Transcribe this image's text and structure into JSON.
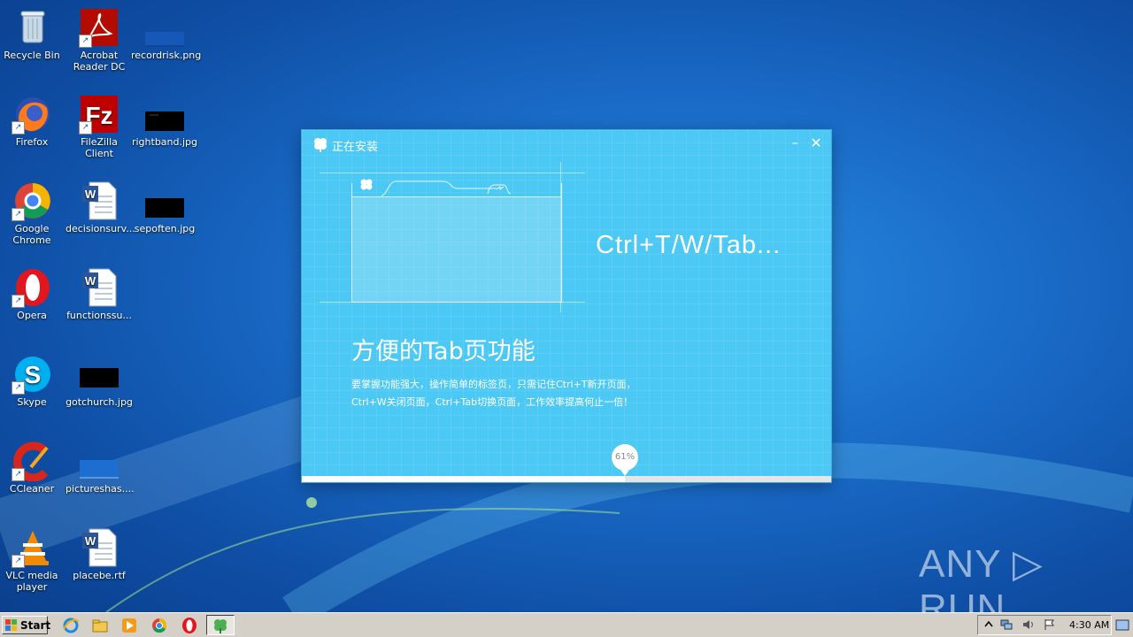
{
  "desktop": {
    "icons": [
      {
        "label": "Recycle Bin",
        "icon": "recycle-bin-icon"
      },
      {
        "label": "Acrobat Reader DC",
        "icon": "acrobat-icon"
      },
      {
        "label": "recordrisk.png",
        "icon": "image-file-icon"
      },
      {
        "label": "Firefox",
        "icon": "firefox-icon"
      },
      {
        "label": "FileZilla Client",
        "icon": "filezilla-icon"
      },
      {
        "label": "rightband.jpg",
        "icon": "image-file-icon"
      },
      {
        "label": "Google Chrome",
        "icon": "chrome-icon"
      },
      {
        "label": "decisionsurv...",
        "icon": "word-doc-icon"
      },
      {
        "label": "sepoften.jpg",
        "icon": "image-file-icon"
      },
      {
        "label": "Opera",
        "icon": "opera-icon"
      },
      {
        "label": "functionssu...",
        "icon": "word-doc-icon"
      },
      {
        "label": "Skype",
        "icon": "skype-icon"
      },
      {
        "label": "gotchurch.jpg",
        "icon": "image-file-icon"
      },
      {
        "label": "CCleaner",
        "icon": "ccleaner-icon"
      },
      {
        "label": "pictureshas....",
        "icon": "image-file-icon"
      },
      {
        "label": "VLC media player",
        "icon": "vlc-icon"
      },
      {
        "label": "placebe.rtf",
        "icon": "word-doc-icon"
      }
    ]
  },
  "installer": {
    "title": "正在安装",
    "minimize": "–",
    "close": "✕",
    "shortcut_text": "Ctrl+T/W/Tab...",
    "headline": "方便的Tab页功能",
    "desc_line1": "要掌握功能强大，操作简单的标签页，只需记住Ctrl+T新开页面，",
    "desc_line2": "Ctrl+W关闭页面，Ctrl+Tab切换页面，工作效率提高何止一倍！",
    "progress": 61,
    "progress_label": "61%",
    "accent": "#4cc8f4"
  },
  "watermark": "ANY ▷ RUN",
  "taskbar": {
    "start_label": "Start",
    "clock": "4:30 AM",
    "quick_launch": [
      "ie-icon",
      "explorer-icon",
      "media-player-icon",
      "chrome-icon",
      "opera-icon"
    ],
    "active_task": "installer-task-icon"
  }
}
